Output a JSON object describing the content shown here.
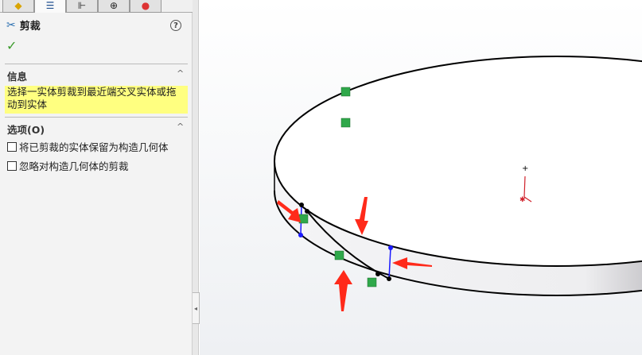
{
  "tabs": [
    {
      "icon": "feature-manager-icon"
    },
    {
      "icon": "property-manager-icon"
    },
    {
      "icon": "configuration-manager-icon"
    },
    {
      "icon": "dimxpert-icon"
    },
    {
      "icon": "display-manager-icon"
    }
  ],
  "header": {
    "title": "剪裁",
    "help": "?",
    "ok": "✓"
  },
  "info": {
    "title": "信息",
    "message": "选择一实体剪裁到最近端交叉实体或拖动到实体",
    "chevron": "^"
  },
  "options": {
    "title": "选项(O)",
    "chevron": "^",
    "items": [
      {
        "label": "将已剪裁的实体保留为构造几何体",
        "checked": false
      },
      {
        "label": "忽略对构造几何体的剪裁",
        "checked": false
      }
    ]
  },
  "colors": {
    "highlight": "#ffff80",
    "arrow": "#ff2a1a",
    "relation": "#2fa84a"
  }
}
